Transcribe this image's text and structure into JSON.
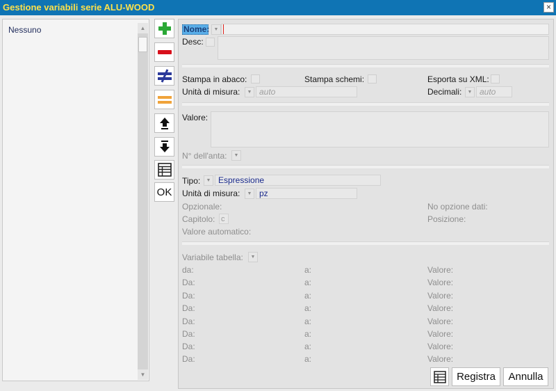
{
  "window": {
    "title": "Gestione variabili serie ALU-WOOD",
    "close_icon": "close-icon"
  },
  "list": {
    "items": [
      "Nessuno"
    ]
  },
  "toolbar": {
    "ok_label": "OK"
  },
  "form": {
    "nome_label": "Nome:",
    "desc_label": "Desc:",
    "stampa_abaco_label": "Stampa in abaco:",
    "stampa_schemi_label": "Stampa schemi:",
    "esporta_xml_label": "Esporta su XML:",
    "unita_misura_label": "Unità di misura:",
    "unita_misura_placeholder": "auto",
    "decimali_label": "Decimali:",
    "decimali_placeholder": "auto",
    "valore_label": "Valore:",
    "n_anta_label": "N° dell'anta:",
    "tipo_label": "Tipo:",
    "tipo_value": "Espressione",
    "unita_misura2_label": "Unità di misura:",
    "unita_misura2_value": "pz",
    "opzionale_label": "Opzionale:",
    "no_opzione_label": "No opzione dati:",
    "capitolo_label": "Capitolo:",
    "capitolo_value": "c",
    "posizione_label": "Posizione:",
    "valore_auto_label": "Valore automatico:",
    "variabile_tabella_label": "Variabile tabella:",
    "table_rows": [
      {
        "col1": "da:",
        "col2": "a:",
        "col3": "Valore:"
      },
      {
        "col1": "Da:",
        "col2": "a:",
        "col3": "Valore:"
      },
      {
        "col1": "Da:",
        "col2": "a:",
        "col3": "Valore:"
      },
      {
        "col1": "Da:",
        "col2": "a:",
        "col3": "Valore:"
      },
      {
        "col1": "Da:",
        "col2": "a:",
        "col3": "Valore:"
      },
      {
        "col1": "Da:",
        "col2": "a:",
        "col3": "Valore:"
      },
      {
        "col1": "Da:",
        "col2": "a:",
        "col3": "Valore:"
      },
      {
        "col1": "Da:",
        "col2": "a:",
        "col3": "Valore:"
      }
    ]
  },
  "buttons": {
    "registra_label": "Registra",
    "annulla_label": "Annulla"
  },
  "colors": {
    "titlebar": "#0f74b4",
    "title_text": "#ffe14a",
    "add": "#2ba836",
    "remove": "#d8101c",
    "not_equal": "#2b3a9a",
    "equal": "#f0a33a"
  }
}
